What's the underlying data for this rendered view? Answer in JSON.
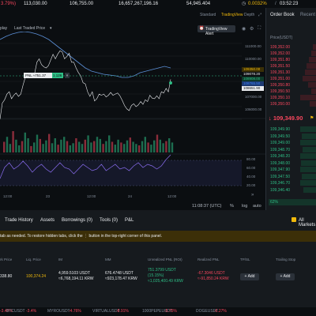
{
  "topbar": {
    "change_pct": "3.79%)",
    "high": "113,030.00",
    "low": "106,755.00",
    "volume": "16,657,267,196.16",
    "turnover": "54,945.404",
    "funding": "0.0032%",
    "countdown": "03:52:23"
  },
  "chart": {
    "views": [
      "Standard",
      "TradingView",
      "Depth"
    ],
    "toolbar": [
      "play",
      "Last Traded Price"
    ],
    "alert_label": "TradingView Alert",
    "pnl_label": "PNL ≈751.37",
    "pnl_value": "1.126",
    "price_ticks": [
      "111000.00",
      "110000.00",
      "109000.00",
      "108000.00",
      "107000.00",
      "106000.00"
    ],
    "price_tags": [
      "109350.00",
      "109078.20",
      "108908.00",
      "108765.50",
      "108651.90"
    ],
    "osc_ticks": [
      "80.00",
      "60.00",
      "40.00",
      "20.00"
    ],
    "time_ticks": [
      "12:00",
      "23",
      "12:00",
      "24",
      "12:00"
    ],
    "clock": "11:08:37 (UTC)",
    "scale_options": [
      "%",
      "log",
      "auto"
    ],
    "price_path": [
      140,
      112,
      106,
      96,
      92,
      104,
      98,
      94,
      100,
      96,
      80,
      66,
      60,
      65,
      64,
      60,
      40,
      34,
      44,
      48,
      50,
      46,
      36,
      26,
      34,
      26,
      20,
      22,
      34,
      30,
      24,
      40,
      40,
      50,
      58,
      64,
      76,
      78,
      92,
      100,
      92,
      108,
      104,
      96,
      98,
      96,
      101,
      98,
      93,
      98,
      96,
      94,
      99,
      107,
      116,
      122,
      125,
      116,
      113,
      118,
      115,
      109,
      114,
      106,
      109,
      98,
      103,
      104,
      99,
      104,
      92,
      94,
      86,
      92,
      70
    ],
    "ma_path": [
      50,
      46,
      43,
      41,
      40,
      41,
      43,
      46,
      50,
      56,
      62,
      68,
      74,
      80,
      86,
      90,
      92,
      94,
      95,
      96,
      98,
      98,
      96,
      92,
      90,
      88,
      86,
      84,
      86
    ],
    "osc_path": [
      226,
      212,
      206,
      214,
      210,
      204,
      210,
      218,
      212,
      208,
      214,
      218,
      212,
      206,
      212,
      214,
      220,
      214,
      208,
      212,
      216,
      214,
      208,
      216,
      212,
      208,
      214,
      212,
      216,
      210,
      206,
      212,
      208,
      210,
      214,
      210,
      202,
      196
    ],
    "volume_bars": [
      15,
      22,
      12,
      30,
      18,
      10,
      16,
      28,
      20,
      9,
      14,
      25,
      19,
      12,
      17,
      26,
      13,
      20,
      11,
      18,
      22,
      16,
      10,
      13,
      20,
      15,
      12,
      18,
      24,
      14,
      16,
      22,
      19,
      12,
      16,
      24,
      15,
      11,
      18,
      14,
      12,
      17,
      21,
      15,
      12,
      10,
      16,
      22,
      14,
      11,
      17,
      25,
      18,
      13,
      16,
      20,
      14
    ]
  },
  "orderbook": {
    "tabs": [
      "Order Book",
      "Recent"
    ],
    "col_header": "Price(USDT)",
    "asks": [
      "109,352.00",
      "109,352.00",
      "109,351.80",
      "109,351.50",
      "109,351.30",
      "109,351.00",
      "109,350.80",
      "109,350.50",
      "109,350.10",
      "109,350.00"
    ],
    "last_price": "109,349.90",
    "bids": [
      "109,349.90",
      "109,349.50",
      "109,349.00",
      "109,348.70",
      "109,348.20",
      "109,348.00",
      "109,347.90",
      "109,347.50",
      "109,346.70",
      "109,346.40"
    ],
    "ratio": "62%"
  },
  "bottom_tabs": [
    "Trade History",
    "Assets",
    "Borrowings (0)",
    "Tools (0)",
    "P&L"
  ],
  "all_markets_label": "All Markets",
  "banner_text": "tab as needed. To restore hidden tabs, click the  ⋮  button in the top-right corner of this panel.",
  "positions": {
    "headers": [
      "rk Price",
      "Liq. Price",
      "IM",
      "MM",
      "Unrealized PNL (ROI)",
      "Realized PNL",
      "TP/SL",
      "Trailing Stop"
    ],
    "row": {
      "mark": "338.80",
      "liq": "100,374.24",
      "im_top": "4,959.5103 USDT",
      "im_bot": "≈6,768,194.11 KRW",
      "mm_top": "676.4748 USDT",
      "mm_bot": "≈923,178.47 KRW",
      "upnl_top": "751.3799 USDT",
      "upnl_mid": "(15.15%)",
      "upnl_bot": "≈1,025,400.49 KRW",
      "rpnl_top": "-67.3046 USDT",
      "rpnl_bot": "≈-91,850.24 KRW",
      "tpsl_btn": "+ Add",
      "trail_btn": "+ Add"
    }
  },
  "ticker": [
    {
      "text": "-3.49%",
      "color": "red"
    },
    {
      "text": "BTCUSDT",
      "color": "muted"
    },
    {
      "text": "-3.4%",
      "color": "red"
    },
    {
      "text": "MYROUSDT",
      "color": "muted"
    },
    {
      "text": "-4.76%",
      "color": "red"
    },
    {
      "text": "VIRTUALUSDT",
      "color": "muted"
    },
    {
      "text": "-8.91%",
      "color": "red"
    },
    {
      "text": "1000PEPEUSDT",
      "color": "muted"
    },
    {
      "text": "-5.75%",
      "color": "red"
    },
    {
      "text": "DOGEUSDT",
      "color": "muted"
    },
    {
      "text": "-6.27%",
      "color": "red"
    }
  ],
  "colors": {
    "up": "#2ebd85",
    "down": "#f6465d",
    "accent": "#f0b90b",
    "ma": "#5b8fd6"
  }
}
